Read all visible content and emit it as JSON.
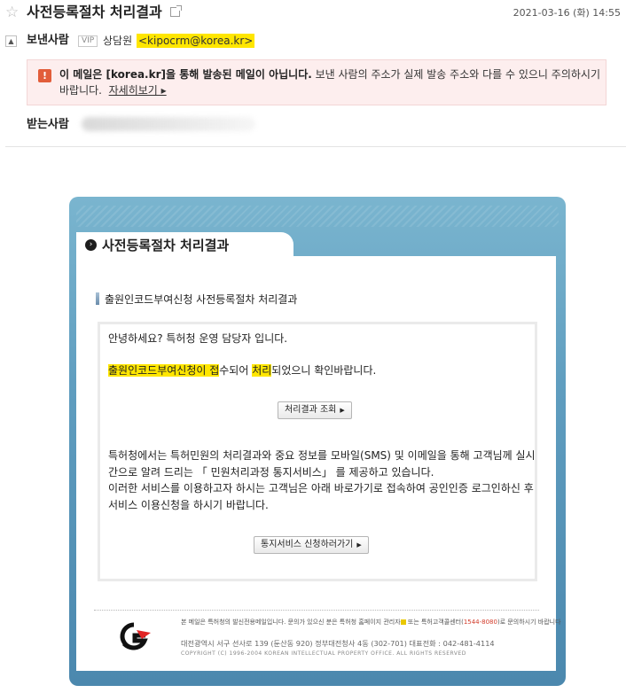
{
  "header": {
    "subject": "사전등록절차 처리결과",
    "date": "2021-03-16 (화) 14:55",
    "sender_label": "보낸사람",
    "vip_badge": "VIP",
    "sender_name": "상담원",
    "sender_email": "<kipocrm@korea.kr>",
    "recipient_label": "받는사람"
  },
  "warning": {
    "bold_text": "이 메일은 [korea.kr]을 통해 발송된 메일이 아닙니다.",
    "text": " 보낸 사람의 주소가 실제 발송 주소와 다를 수 있으니 주의하시기 바랍니다.",
    "link_label": "자세히보기 ▸"
  },
  "body": {
    "tab_title": "사전등록절차 처리결과",
    "section_title": "출원인코드부여신청 사전등록절차 처리결과",
    "greeting": "안녕하세요? 특허청 운영 담당자 입니다.",
    "line2_part1": "출원인코드부여신청이 접",
    "line2_part2": "수되어 ",
    "line2_part3": "처리",
    "line2_part4": "되었으니 확인바랍니다.",
    "button_result": "처리결과 조회",
    "paragraph1": "특허청에서는 특허민원의 처리결과와 중요 정보를 모바일(SMS) 및 이메일을 통해 고객님께 실시간으로 알려 드리는 「 민원처리과정 통지서비스」 를 제공하고 있습니다.",
    "paragraph2": "이러한 서비스를 이용하고자 하시는 고객님은 아래 바로가기로 접속하여 공인인증 로그인하신 후 서비스 이용신청을 하시기 바랍니다.",
    "button_notify": "통지서비스 신청하러가기"
  },
  "footer": {
    "line1_a": "본 메일은 특허청의 발신전용메일입니다. 문의가 있으신 분은 특허청 홈페이지 관리자",
    "line1_b": " 또는 특허고객콜센터(",
    "line1_phone": "1544-8080",
    "line1_c": ")로 문의하시기 바랍니다",
    "address": "대전광역시 서구 선사로 139 (둔산동 920) 정부대전청사 4동 (302-701)     대표전화 : 042-481-4114",
    "copyright": "COPYRIGHT (C) 1996-2004 KOREAN INTELLECTUAL PROPERTY OFFICE. ALL RIGHTS RESERVED"
  },
  "colors": {
    "highlight": "#ffe600",
    "warning_bg": "#fdeeee",
    "warning_icon": "#e25d3a",
    "frame_blue": "#5f9dbf"
  },
  "icons": {
    "favorite": "star-icon",
    "external": "external-link-icon",
    "collapse": "collapse-icon",
    "warning": "exclamation-icon",
    "logo": "kipo-logo-icon"
  }
}
